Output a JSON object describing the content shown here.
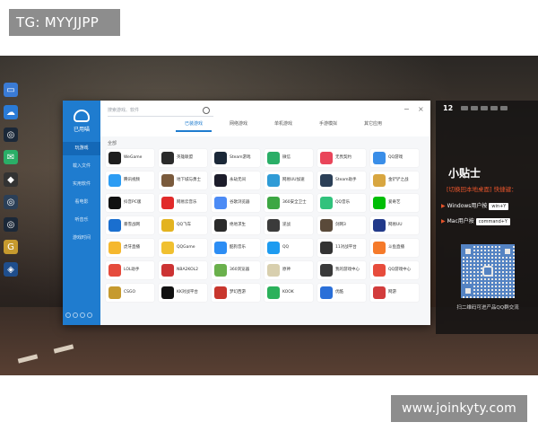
{
  "overlay": {
    "tag_top": "TG: MYYJJPP",
    "tag_bottom": "www.joinkyty.com"
  },
  "app": {
    "logo_text": "已用喵",
    "search_placeholder": "搜索游戏、软件",
    "nav": [
      "玩游戏",
      "载入文件",
      "实用软件",
      "看电影",
      "听音乐",
      "游戏时间"
    ],
    "tabs": [
      "已装游戏",
      "网络游戏",
      "单机游戏",
      "手游模拟",
      "其它应用"
    ],
    "active_tab": 0,
    "breadcrumb": "全部",
    "grid_rows": [
      [
        {
          "label": "WeGame",
          "icon": "wegame-icon",
          "color": "#1e1e1e"
        },
        {
          "label": "英雄联盟",
          "icon": "lol-icon",
          "color": "#2b2b2b"
        },
        {
          "label": "Steam游戏",
          "icon": "steam-icon",
          "color": "#1b2838"
        },
        {
          "label": "微信",
          "icon": "wechat-icon",
          "color": "#2aae67"
        },
        {
          "label": "无畏契约",
          "icon": "valorant-icon",
          "color": "#e9455a"
        },
        {
          "label": "QQ游戏",
          "icon": "qq-game-icon",
          "color": "#3a8ee8"
        }
      ],
      [
        {
          "label": "腾讯视频",
          "icon": "tencent-video-icon",
          "color": "#2c9cf3"
        },
        {
          "label": "地下城与勇士",
          "icon": "dnf-icon",
          "color": "#7a5a3c"
        },
        {
          "label": "永劫无间",
          "icon": "yongjie-icon",
          "color": "#1c1c2a"
        },
        {
          "label": "网易UU加速",
          "icon": "uu-icon",
          "color": "#2f9bd6"
        },
        {
          "label": "Steam助手",
          "icon": "steam-helper-icon",
          "color": "#2b3f57"
        },
        {
          "label": "金铲铲之战",
          "icon": "jcc-icon",
          "color": "#d8a640"
        }
      ],
      [
        {
          "label": "抖音PC版",
          "icon": "douyin-icon",
          "color": "#111111"
        },
        {
          "label": "网易云音乐",
          "icon": "netease-music-icon",
          "color": "#e12a2a"
        },
        {
          "label": "谷歌浏览器",
          "icon": "chrome-icon",
          "color": "#4c8bf5"
        },
        {
          "label": "360安全卫士",
          "icon": "360-icon",
          "color": "#3da743"
        },
        {
          "label": "QQ音乐",
          "icon": "qq-music-icon",
          "color": "#31c27c"
        },
        {
          "label": "爱奇艺",
          "icon": "iqiyi-icon",
          "color": "#00be06"
        }
      ],
      [
        {
          "label": "暴雪战网",
          "icon": "battlenet-icon",
          "color": "#1a6fcf"
        },
        {
          "label": "QQ飞车",
          "icon": "qq-speed-icon",
          "color": "#e3b320"
        },
        {
          "label": "绝地求生",
          "icon": "pubg-icon",
          "color": "#2a2a2a"
        },
        {
          "label": "逆战",
          "icon": "nizhan-icon",
          "color": "#3b3b3b"
        },
        {
          "label": "剑网3",
          "icon": "jx3-icon",
          "color": "#5a4a3a"
        },
        {
          "label": "网易UU",
          "icon": "uu-booster-icon",
          "color": "#223a8a"
        }
      ],
      [
        {
          "label": "虎牙直播",
          "icon": "huya-icon",
          "color": "#f5b82e"
        },
        {
          "label": "QQGame",
          "icon": "qqgame-icon",
          "color": "#f0c030"
        },
        {
          "label": "酷狗音乐",
          "icon": "kugou-icon",
          "color": "#2c8df4"
        },
        {
          "label": "QQ",
          "icon": "qq-icon",
          "color": "#1d9bf0"
        },
        {
          "label": "11对战平台",
          "icon": "11-platform-icon",
          "color": "#333333"
        },
        {
          "label": "斗鱼直播",
          "icon": "douyu-icon",
          "color": "#f57a2a"
        }
      ],
      [
        {
          "label": "LOL助手",
          "icon": "lol-helper-icon",
          "color": "#e54b3c"
        },
        {
          "label": "NBA2KOL2",
          "icon": "nba2k-icon",
          "color": "#c33"
        },
        {
          "label": "360浏览器",
          "icon": "360browser-icon",
          "color": "#6ab04c"
        },
        {
          "label": "原神",
          "icon": "genshin-icon",
          "color": "#d8cfae"
        },
        {
          "label": "我的游戏中心",
          "icon": "game-center-icon",
          "color": "#3a3a3a"
        },
        {
          "label": "QQ游戏中心",
          "icon": "qq-center-icon",
          "color": "#e74c3c"
        }
      ],
      [
        {
          "label": "CSGO",
          "icon": "csgo-icon",
          "color": "#c69a2e"
        },
        {
          "label": "KK对战平台",
          "icon": "kk-icon",
          "color": "#111111"
        },
        {
          "label": "梦幻西游",
          "icon": "menghuan-icon",
          "color": "#c8362d"
        },
        {
          "label": "KOOK",
          "icon": "kook-icon",
          "color": "#2bb15b"
        },
        {
          "label": "优酷",
          "icon": "youku-icon",
          "color": "#2a6fd8"
        },
        {
          "label": "网游",
          "icon": "netgame-icon",
          "color": "#d23c3c"
        }
      ]
    ]
  },
  "tips": {
    "clock": "12",
    "title": "小贴士",
    "subtitle": "[切换回本地桌面] 快捷键：",
    "win_label": "Windows用户按",
    "win_key": "win+Y",
    "mac_label": "Mac用户按",
    "mac_key": "command+Y",
    "qr_caption": "扫二维码可进产品QQ群交流"
  }
}
